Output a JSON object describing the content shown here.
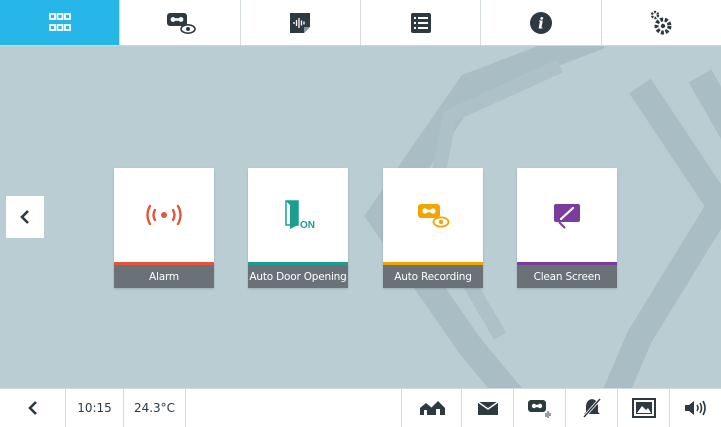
{
  "top_tabs": [
    {
      "icon": "grid-icon",
      "active": true
    },
    {
      "icon": "videomail-view-icon",
      "active": false
    },
    {
      "icon": "audio-message-icon",
      "active": false
    },
    {
      "icon": "list-icon",
      "active": false
    },
    {
      "icon": "info-icon",
      "active": false
    },
    {
      "icon": "settings-gears-icon",
      "active": false
    }
  ],
  "cards": [
    {
      "label": "Alarm",
      "icon": "alarm-icon",
      "accent": "#e2573b"
    },
    {
      "label": "Auto Door Opening",
      "icon": "door-on-icon",
      "accent": "#1a9e90"
    },
    {
      "label": "Auto Recording",
      "icon": "recording-view-icon",
      "accent": "#f2a400"
    },
    {
      "label": "Clean Screen",
      "icon": "clean-screen-icon",
      "accent": "#7b3c9c"
    }
  ],
  "status": {
    "time": "10:15",
    "temperature": "24.3°C"
  },
  "bottom_icons": [
    "home-icon",
    "envelope-icon",
    "videomail-icon",
    "mute-icon",
    "picture-icon",
    "volume-icon"
  ],
  "colors": {
    "active_tab": "#27b6e8",
    "background": "#b9cdd3"
  }
}
